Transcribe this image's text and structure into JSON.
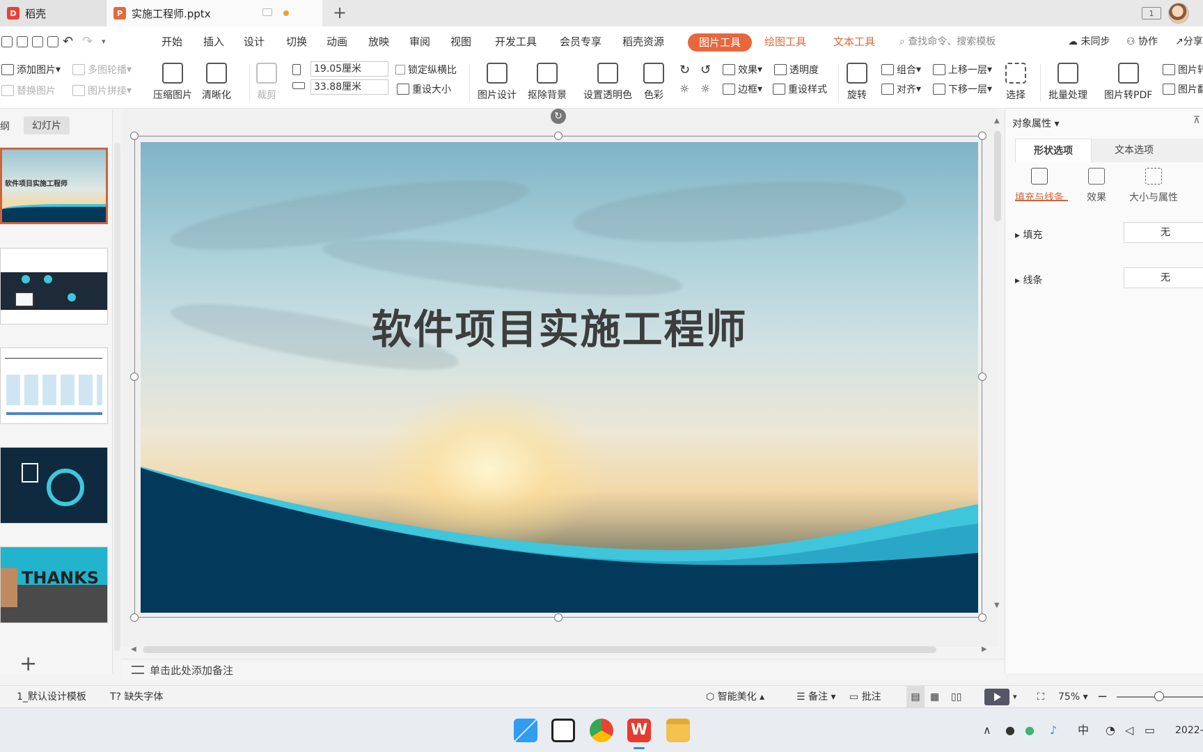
{
  "tabs": [
    {
      "label": "稻壳"
    },
    {
      "label": "实施工程师.pptx"
    }
  ],
  "menu": {
    "items": [
      "开始",
      "插入",
      "设计",
      "切换",
      "动画",
      "放映",
      "审阅",
      "视图",
      "开发工具",
      "会员专享",
      "稻壳资源"
    ],
    "picture_tools": "图片工具",
    "drawing_tools": "绘图工具",
    "text_tools": "文本工具",
    "search_placeholder": "查找命令、搜索模板",
    "unsynced": "未同步",
    "collab": "协作",
    "share": "分享"
  },
  "ribbon": {
    "add_picture": "添加图片",
    "multi_carousel": "多图轮播",
    "replace_picture": "替换图片",
    "picture_stitch": "图片拼接",
    "compress": "压缩图片",
    "sharpen": "清晰化",
    "crop": "裁剪",
    "height": "19.05厘米",
    "width": "33.88厘米",
    "lock_ratio": "锁定纵横比",
    "reset_size": "重设大小",
    "picture_design": "图片设计",
    "remove_bg": "抠除背景",
    "set_transparent": "设置透明色",
    "color": "色彩",
    "effects": "效果",
    "transparency": "透明度",
    "border": "边框",
    "reset_style": "重设样式",
    "rotate": "旋转",
    "group": "组合",
    "align": "对齐",
    "bring_forward": "上移一层",
    "send_backward": "下移一层",
    "select": "选择",
    "batch": "批量处理",
    "to_pdf": "图片转PDF",
    "picture_more1": "图片转",
    "picture_more2": "图片翻"
  },
  "left_pane": {
    "tab_outline": "大纲",
    "tab_slides": "幻灯片",
    "thumb1_title": "软件项目实施工程师",
    "thumb5_title": "THANKS"
  },
  "slide": {
    "title": "软件项目实施工程师"
  },
  "notes": {
    "placeholder": "单击此处添加备注"
  },
  "right_pane": {
    "title": "对象属性",
    "tab_shape": "形状选项",
    "tab_text": "文本选项",
    "sub_fill_line": "填充与线条",
    "sub_effects": "效果",
    "sub_size": "大小与属性",
    "fill_label": "填充",
    "fill_value": "无",
    "line_label": "线条",
    "line_value": "无"
  },
  "statusbar": {
    "template": "1_默认设计模板",
    "missing_font": "缺失字体",
    "smart_beautify": "智能美化",
    "notes": "备注",
    "comments": "批注",
    "zoom": "75%"
  },
  "taskbar": {
    "ime": "中",
    "date": "2022-"
  },
  "colors": {
    "accent": "#e8673c",
    "slide_wave_dark": "#033a5c",
    "slide_wave_light": "#3fc6dc"
  }
}
